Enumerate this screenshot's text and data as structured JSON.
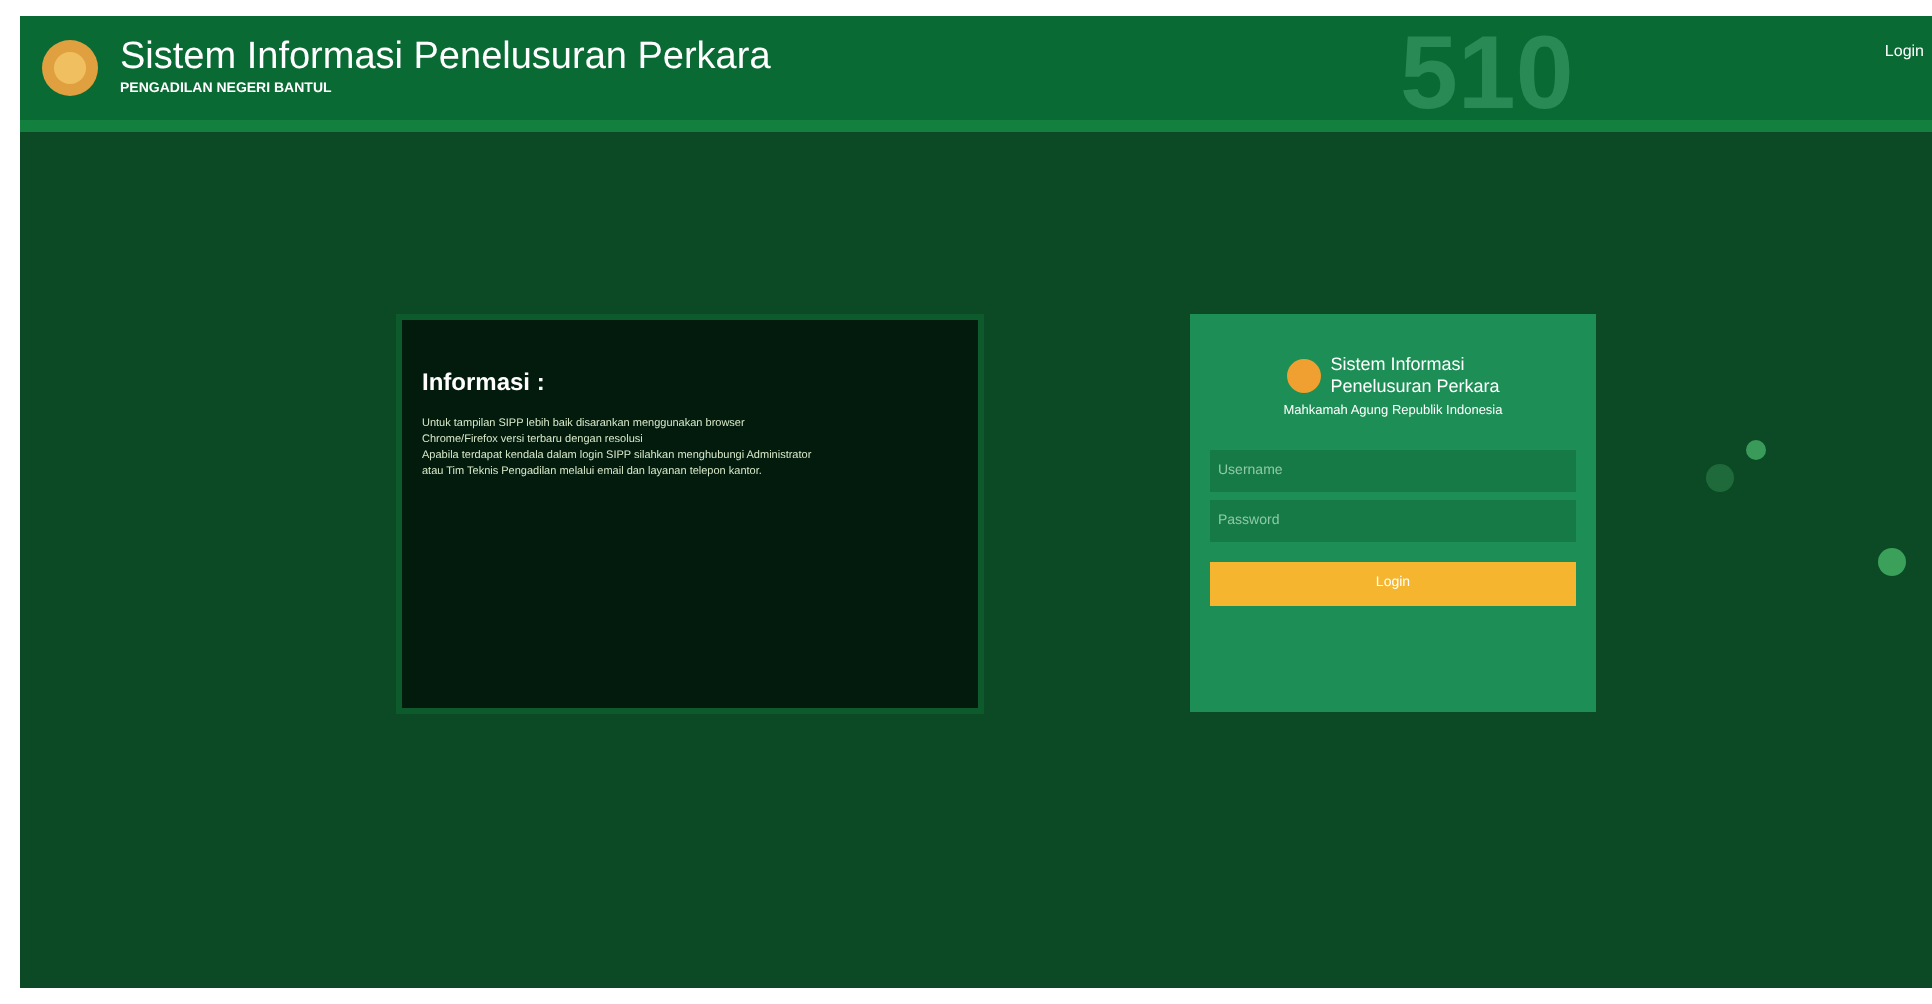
{
  "header": {
    "title": "Sistem Informasi Penelusuran Perkara",
    "subtitle": "PENGADILAN NEGERI BANTUL",
    "version": "510",
    "login_link": "Login"
  },
  "info": {
    "title": "Informasi :",
    "lines": [
      "Untuk tampilan SIPP lebih baik disarankan menggunakan browser",
      "Chrome/Firefox versi terbaru dengan resolusi",
      "Apabila terdapat kendala dalam login SIPP silahkan menghubungi Administrator",
      "atau Tim Teknis Pengadilan melalui email dan layanan telepon kantor."
    ]
  },
  "login": {
    "title_line_1": "Sistem Informasi",
    "title_line_2": "Penelusuran Perkara",
    "subtitle": "Mahkamah Agung Republik Indonesia",
    "username_placeholder": "Username",
    "password_placeholder": "Password",
    "button": "Login"
  }
}
